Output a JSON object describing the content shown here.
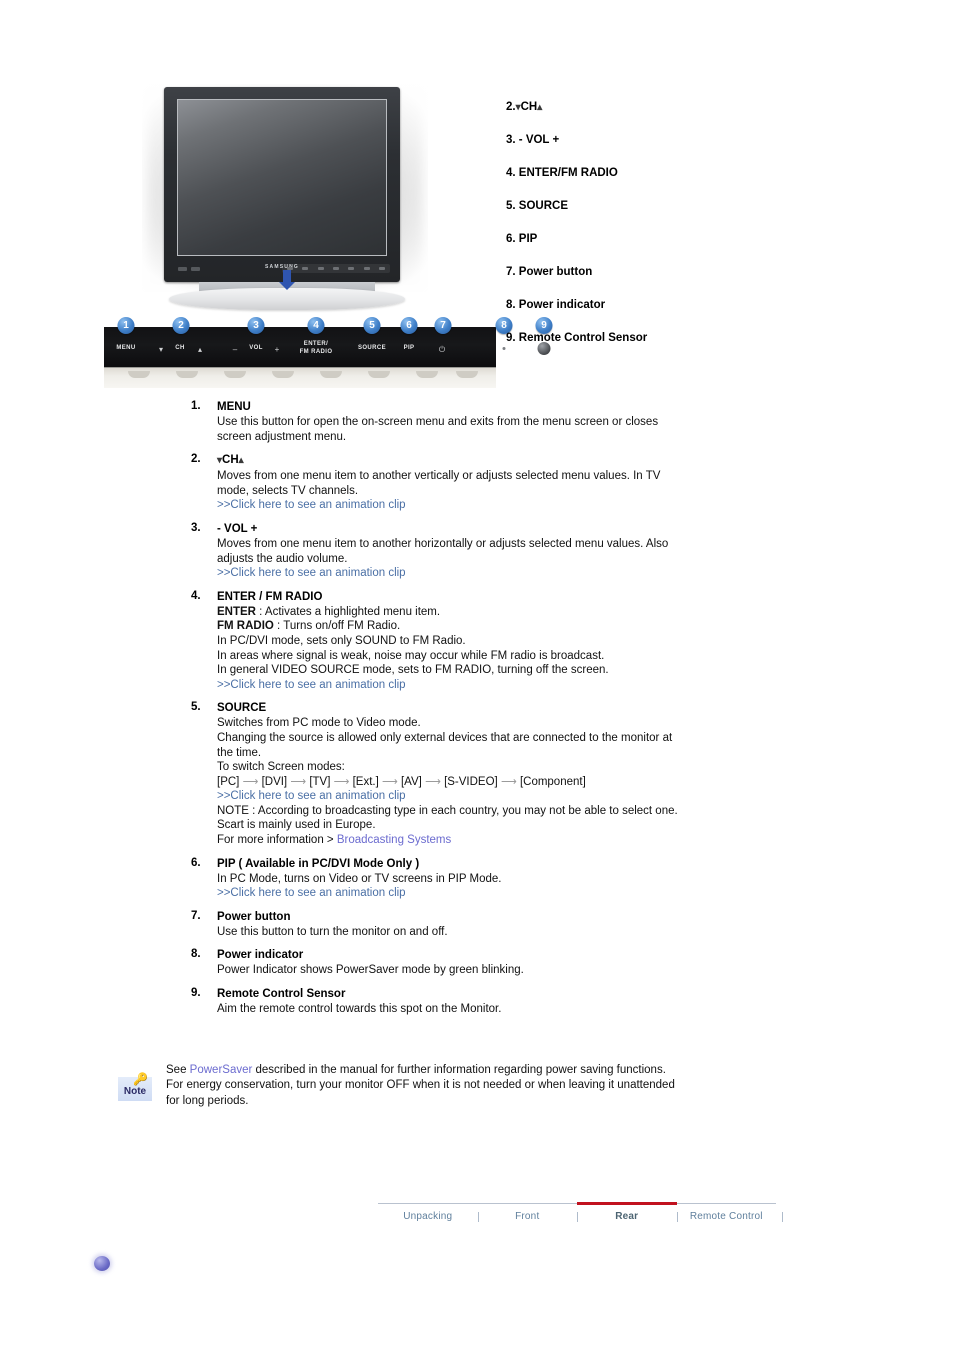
{
  "product": {
    "brand": "SAMSUNG"
  },
  "control_panel": {
    "buttons": [
      {
        "badge": "1",
        "label": "MENU",
        "type": "text"
      },
      {
        "badge": "2",
        "label": "CH",
        "type": "ch"
      },
      {
        "badge": "3",
        "label": "VOL",
        "type": "vol"
      },
      {
        "badge": "4",
        "label": "ENTER/\nFM RADIO",
        "type": "twoline",
        "line1": "ENTER/",
        "line2": "FM RADIO"
      },
      {
        "badge": "5",
        "label": "SOURCE",
        "type": "text"
      },
      {
        "badge": "6",
        "label": "PIP",
        "type": "text"
      },
      {
        "badge": "7",
        "label": "⏻",
        "type": "power"
      },
      {
        "badge": "8",
        "label": "",
        "type": "dot"
      },
      {
        "badge": "9",
        "label": "",
        "type": "sensor"
      }
    ]
  },
  "index_list": [
    {
      "num": "2.",
      "label": "CH",
      "has_chevrons": true
    },
    {
      "num": "3.",
      "label": "- VOL +",
      "has_chevrons": false
    },
    {
      "num": "4.",
      "label": "ENTER/FM RADIO",
      "has_chevrons": false
    },
    {
      "num": "5.",
      "label": "SOURCE",
      "has_chevrons": false
    },
    {
      "num": "6.",
      "label": "PIP",
      "has_chevrons": false
    },
    {
      "num": "7.",
      "label": "Power button",
      "has_chevrons": false
    },
    {
      "num": "8.",
      "label": "Power indicator",
      "has_chevrons": false
    },
    {
      "num": "9.",
      "label": "Remote Control Sensor",
      "has_chevrons": false
    }
  ],
  "descriptions": {
    "item1": {
      "num": "1.",
      "title": "MENU",
      "line1": "Use this button for open the on-screen menu and exits from the menu screen or closes",
      "line2": "screen adjustment menu."
    },
    "item2": {
      "num": "2.",
      "title": "CH",
      "line1": "Moves from one menu item to another vertically or adjusts selected menu values. In TV",
      "line2": "mode, selects TV channels.",
      "link": ">>Click here to see an animation clip"
    },
    "item3": {
      "num": "3.",
      "title": "- VOL +",
      "line1": "Moves from one menu item to another horizontally or adjusts selected menu values. Also",
      "line2": "adjusts the audio volume.",
      "link": ">>Click here to see an animation clip"
    },
    "item4": {
      "num": "4.",
      "title": "ENTER / FM RADIO",
      "enter_label": "ENTER",
      "enter_text": " : Activates a highlighted menu item.",
      "fm_label": "FM RADIO",
      "fm_text": " : Turns on/off FM Radio.",
      "line3": "In PC/DVI mode, sets only SOUND to FM Radio.",
      "line4": "In areas where signal is weak, noise may occur while FM radio is broadcast.",
      "line5": "In general VIDEO SOURCE mode, sets to FM RADIO, turning off the screen.",
      "link": ">>Click here to see an animation clip"
    },
    "item5": {
      "num": "5.",
      "title": "SOURCE",
      "line1": "Switches from PC mode to Video mode.",
      "line2": "Changing the source is allowed only external devices that are connected to the monitor at",
      "line3": "the time.",
      "line4": "To switch Screen modes:",
      "modes": [
        "[PC]",
        "[DVI]",
        "[TV]",
        "[Ext.]",
        "[AV]",
        "[S-VIDEO]",
        "[Component]"
      ],
      "link": ">>Click here to see an animation clip",
      "note1": "NOTE : According to broadcasting type in each country, you may not be able to select one.",
      "note2": "Scart is mainly used in Europe.",
      "more_prefix": "For more information > ",
      "more_link": "Broadcasting Systems"
    },
    "item6": {
      "num": "6.",
      "title": "PIP ( Available in PC/DVI Mode Only )",
      "line1": "In PC Mode, turns on Video or TV screens in PIP Mode.",
      "link": ">>Click here to see an animation clip"
    },
    "item7": {
      "num": "7.",
      "title": "Power button",
      "line1": "Use this button to turn the monitor on and off."
    },
    "item8": {
      "num": "8.",
      "title": "Power indicator",
      "line1": "Power Indicator shows PowerSaver mode by green blinking."
    },
    "item9": {
      "num": "9.",
      "title": "Remote Control Sensor",
      "line1": "Aim the remote control towards this spot on the Monitor."
    }
  },
  "note": {
    "icon_label": "Note",
    "see_prefix": "See ",
    "link": "PowerSaver",
    "see_suffix": " described in the manual for further information regarding power saving functions.",
    "line2": "For energy conservation, turn your monitor OFF when it is not needed or when leaving it unattended",
    "line3": "for long periods."
  },
  "footer_nav": {
    "tabs": [
      {
        "label": "Unpacking",
        "active": false
      },
      {
        "label": "Front",
        "active": false
      },
      {
        "label": "Rear",
        "active": true
      },
      {
        "label": "Remote Control",
        "active": false
      }
    ]
  },
  "colors": {
    "link_blue": "#4a6fa5",
    "link_purple": "#6b6bcf",
    "active_tab_rule": "#c1121f",
    "badge_blue": "#3f7fc8",
    "nav_text": "#5f7f9c"
  }
}
